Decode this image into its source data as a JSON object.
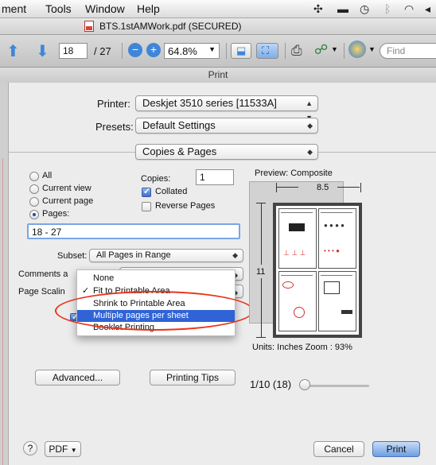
{
  "menubar": {
    "items": [
      "ment",
      "Tools",
      "Window",
      "Help"
    ]
  },
  "window": {
    "title": "BTS.1stAMWork.pdf (SECURED)"
  },
  "toolbar": {
    "page_current": "18",
    "page_total": "/ 27",
    "zoom": "64.8%",
    "search_placeholder": "Find"
  },
  "print": {
    "title": "Print",
    "printer_label": "Printer:",
    "printer_value": "Deskjet 3510 series [11533A]",
    "presets_label": "Presets:",
    "presets_value": "Default Settings",
    "section_value": "Copies & Pages",
    "ranges": [
      "All",
      "Current view",
      "Current page",
      "Pages:"
    ],
    "pages_value": "18 - 27",
    "copies_label": "Copies:",
    "copies_value": "1",
    "collated_label": "Collated",
    "reverse_label": "Reverse Pages",
    "subset_label": "Subset:",
    "subset_value": "All Pages in Range",
    "comments_label": "Comments a",
    "page_scaling_label": "Page Scalin",
    "scaling_menu": {
      "items": [
        "None",
        "Fit to Printable Area",
        "Shrink to Printable Area",
        "Multiple pages per sheet",
        "Booklet Printing"
      ],
      "checked_index": 1,
      "highlighted_index": 3
    },
    "advanced_label": "Advanced...",
    "printing_tips_label": "Printing Tips",
    "preview_label": "Preview: Composite",
    "width_dim": "8.5",
    "height_dim": "11",
    "units_label": "Units: Inches  Zoom :  93%",
    "page_counter": "1/10 (18)",
    "help_label": "?",
    "pdf_label": "PDF",
    "cancel_label": "Cancel",
    "print_label": "Print"
  },
  "colors": {
    "accent": "#2f63d6",
    "annotation_circle": "#e8331a"
  }
}
